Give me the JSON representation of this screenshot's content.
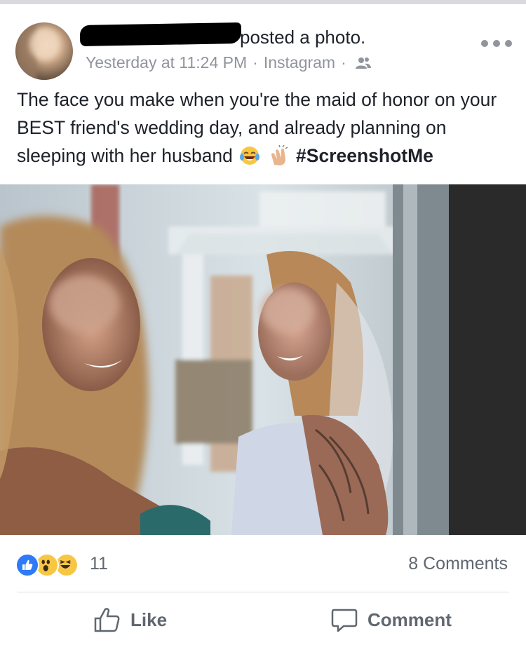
{
  "post": {
    "action_text": "posted a photo.",
    "timestamp": "Yesterday at 11:24 PM",
    "separator": "·",
    "source": "Instagram",
    "audience_icon": "friends-icon",
    "text_main": "The face you make when you're the maid of honor on your BEST friend's wedding day, and already planning on sleeping with her husband",
    "hashtag": "#ScreenshotMe"
  },
  "reactions": {
    "icons": [
      "like-icon",
      "wow-icon",
      "haha-icon"
    ],
    "count": "11",
    "comments": "8 Comments"
  },
  "actions": {
    "like_label": "Like",
    "comment_label": "Comment"
  },
  "colors": {
    "text": "#1d2129",
    "meta": "#90949c",
    "action": "#606770",
    "like_blue": "#2e7af7",
    "emoji_yellow": "#f7c744"
  }
}
